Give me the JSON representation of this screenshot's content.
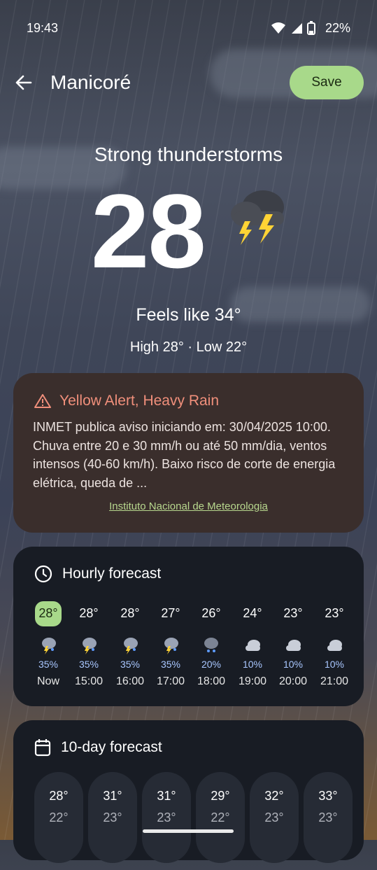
{
  "status_bar": {
    "time": "19:43",
    "battery": "22%"
  },
  "header": {
    "city": "Manicoré",
    "save_label": "Save"
  },
  "current": {
    "condition": "Strong thunderstorms",
    "temperature": "28",
    "feels_like": "Feels like 34°",
    "high_low": "High 28° · Low 22°"
  },
  "alert": {
    "title": "Yellow Alert, Heavy Rain",
    "body": "INMET publica aviso iniciando em: 30/04/2025 10:00. Chuva entre 20 e 30 mm/h ou até 50 mm/dia, ventos intensos (40-60 km/h). Baixo risco de corte de energia elétrica, queda de ...",
    "source": "Instituto Nacional de Meteorologia",
    "color": "#f08f7b"
  },
  "hourly": {
    "title": "Hourly forecast",
    "items": [
      {
        "temp": "28°",
        "pct": "35%",
        "time": "Now",
        "icon": "thunderstorm-icon"
      },
      {
        "temp": "28°",
        "pct": "35%",
        "time": "15:00",
        "icon": "thunderstorm-icon"
      },
      {
        "temp": "28°",
        "pct": "35%",
        "time": "16:00",
        "icon": "thunderstorm-icon"
      },
      {
        "temp": "27°",
        "pct": "35%",
        "time": "17:00",
        "icon": "thunderstorm-icon"
      },
      {
        "temp": "26°",
        "pct": "20%",
        "time": "18:00",
        "icon": "rain-icon"
      },
      {
        "temp": "24°",
        "pct": "10%",
        "time": "19:00",
        "icon": "cloud-icon"
      },
      {
        "temp": "23°",
        "pct": "10%",
        "time": "20:00",
        "icon": "cloud-icon"
      },
      {
        "temp": "23°",
        "pct": "10%",
        "time": "21:00",
        "icon": "cloud-icon"
      }
    ]
  },
  "ten_day": {
    "title": "10-day forecast",
    "days": [
      {
        "high": "28°",
        "low": "22°"
      },
      {
        "high": "31°",
        "low": "23°"
      },
      {
        "high": "31°",
        "low": "23°"
      },
      {
        "high": "29°",
        "low": "22°"
      },
      {
        "high": "32°",
        "low": "23°"
      },
      {
        "high": "33°",
        "low": "23°"
      }
    ]
  },
  "colors": {
    "accent": "#a8d98a",
    "percent": "#a9c7ff"
  }
}
